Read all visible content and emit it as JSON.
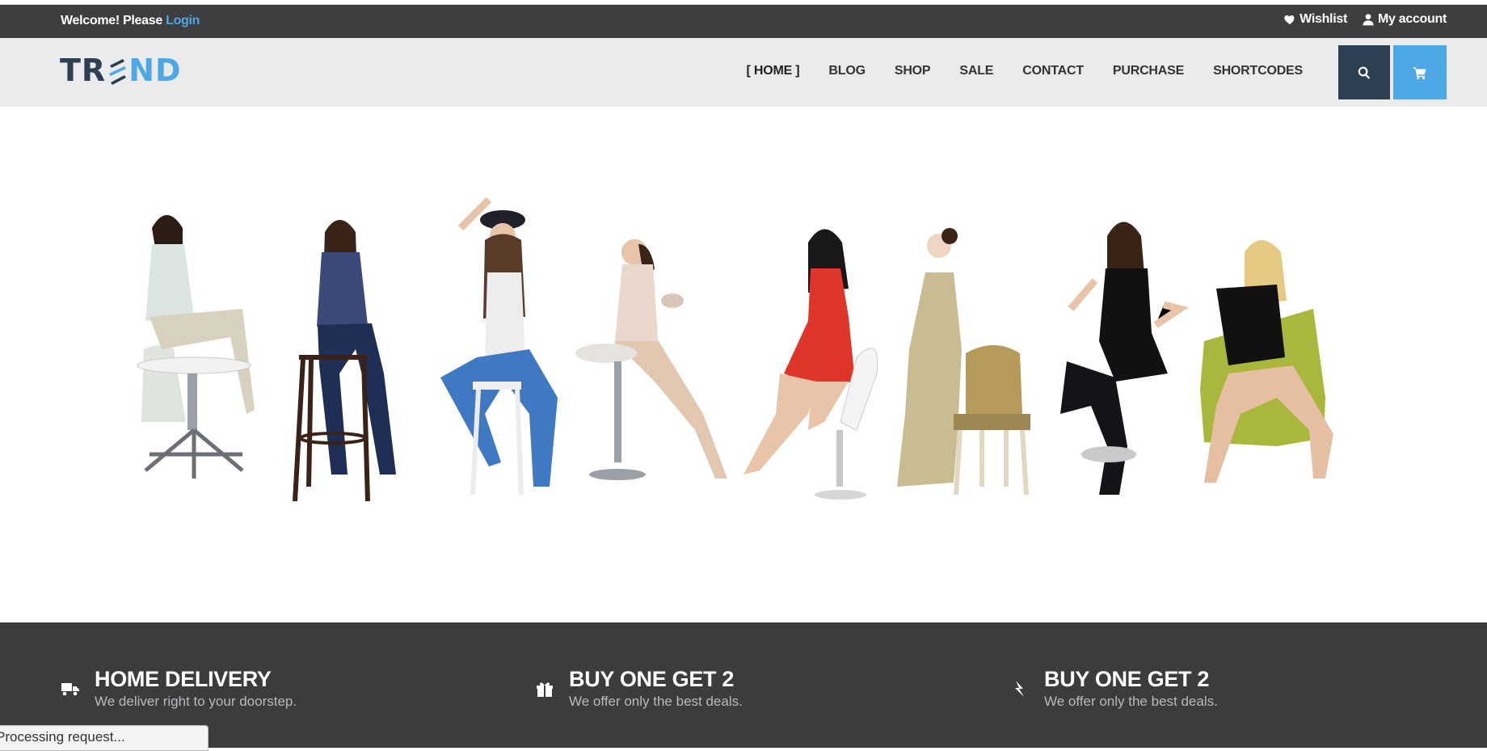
{
  "topbar": {
    "welcome_text": "Welcome! Please ",
    "login_label": "Login",
    "wishlist_label": "Wishlist",
    "account_label": "My account"
  },
  "header": {
    "logo_left": "TR",
    "logo_right": "ND"
  },
  "nav": {
    "items": [
      {
        "label": "[ HOME ]"
      },
      {
        "label": "BLOG"
      },
      {
        "label": "SHOP"
      },
      {
        "label": "SALE"
      },
      {
        "label": "CONTACT"
      },
      {
        "label": "PURCHASE"
      },
      {
        "label": "SHORTCODES"
      }
    ]
  },
  "icons": {
    "search": "search-icon",
    "cart": "cart-icon",
    "wishlist": "heart-icon",
    "account": "user-icon"
  },
  "features": [
    {
      "icon": "truck-icon",
      "title": "HOME DELIVERY",
      "desc": "We deliver right to your doorstep."
    },
    {
      "icon": "gift-icon",
      "title": "BUY ONE GET 2",
      "desc": "We offer only the best deals."
    },
    {
      "icon": "bolt-icon",
      "title": "BUY ONE GET 2",
      "desc": "We offer only the best deals."
    }
  ],
  "status": {
    "processing": "Processing request..."
  },
  "colors": {
    "accent": "#4fa8e6",
    "dark": "#2e3f52",
    "topbar": "#3d3e40",
    "header": "#e9ebec",
    "features_bg": "#3b3c3e"
  }
}
